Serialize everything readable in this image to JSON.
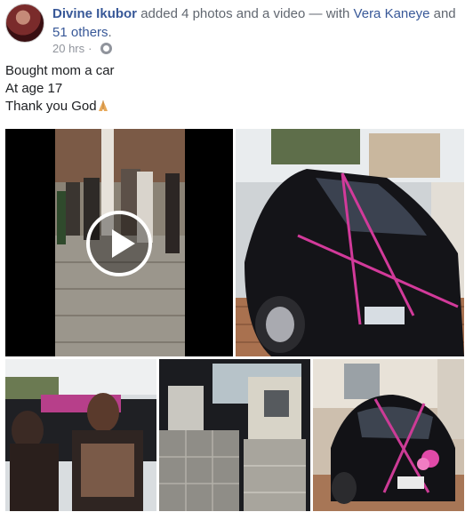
{
  "header": {
    "author": "Divine Ikubor",
    "action": " added 4 photos and a video — with ",
    "tagged": "Vera Kaneye",
    "joiner": " and ",
    "others": "51 others",
    "period": ".",
    "time": "20 hrs",
    "separator": "·",
    "privacy_icon": "globe-icon"
  },
  "post": {
    "lines": [
      "Bought mom a car",
      "At age 17",
      "Thank you God"
    ],
    "emoji_icon": "praying-hands-icon"
  },
  "media": {
    "video_icon": "play-icon",
    "photo_count": 4
  },
  "colors": {
    "link": "#385898",
    "meta": "#90949c",
    "text": "#1c1e21"
  }
}
